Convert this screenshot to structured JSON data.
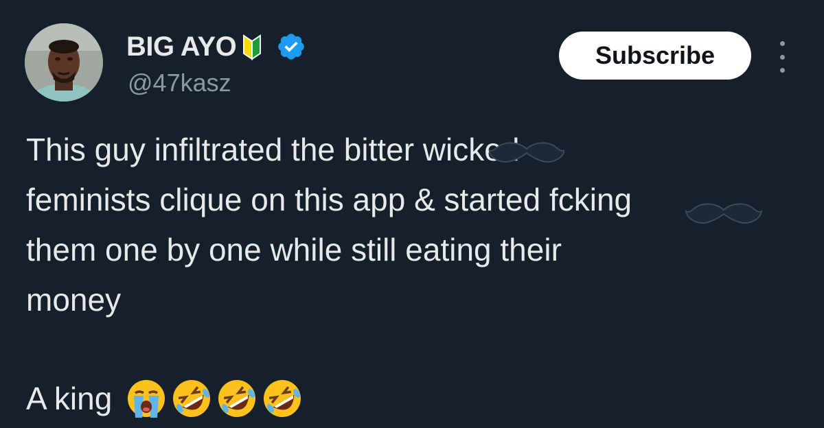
{
  "author": {
    "display_name": "BIG AYO",
    "handle": "@47kasz",
    "name_badge_icon": "japanese-beginner-symbol-icon",
    "verified_icon": "verified-badge-icon",
    "verified_color": "#1d9bf0"
  },
  "actions": {
    "subscribe_label": "Subscribe",
    "more_icon": "more-vertical-icon"
  },
  "tweet": {
    "lines": [
      "This guy infiltrated the bitter wicked",
      "feminists clique on this app & started fcking",
      "them one by one while still eating their",
      "money"
    ],
    "signoff": "A king",
    "signoff_emojis": [
      "loudly-crying-face-icon",
      "rolling-on-floor-laughing-icon",
      "rolling-on-floor-laughing-icon",
      "rolling-on-floor-laughing-icon"
    ]
  },
  "colors": {
    "background": "#15202b",
    "text": "#e7e9ea",
    "secondary_text": "#8b98a5"
  }
}
